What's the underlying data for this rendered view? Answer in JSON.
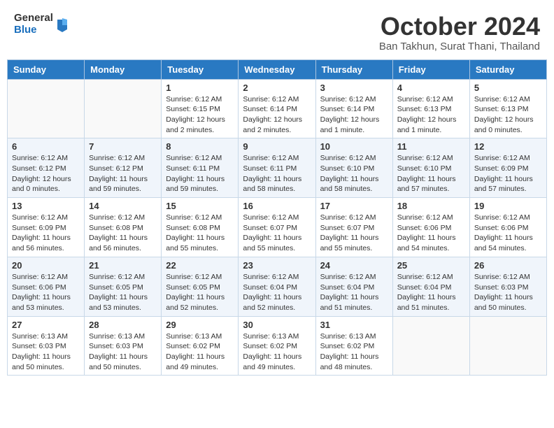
{
  "header": {
    "logo": {
      "general": "General",
      "blue": "Blue"
    },
    "title": "October 2024",
    "location": "Ban Takhun, Surat Thani, Thailand"
  },
  "days_of_week": [
    "Sunday",
    "Monday",
    "Tuesday",
    "Wednesday",
    "Thursday",
    "Friday",
    "Saturday"
  ],
  "weeks": [
    [
      {
        "day": "",
        "detail": ""
      },
      {
        "day": "",
        "detail": ""
      },
      {
        "day": "1",
        "detail": "Sunrise: 6:12 AM\nSunset: 6:15 PM\nDaylight: 12 hours and 2 minutes."
      },
      {
        "day": "2",
        "detail": "Sunrise: 6:12 AM\nSunset: 6:14 PM\nDaylight: 12 hours and 2 minutes."
      },
      {
        "day": "3",
        "detail": "Sunrise: 6:12 AM\nSunset: 6:14 PM\nDaylight: 12 hours and 1 minute."
      },
      {
        "day": "4",
        "detail": "Sunrise: 6:12 AM\nSunset: 6:13 PM\nDaylight: 12 hours and 1 minute."
      },
      {
        "day": "5",
        "detail": "Sunrise: 6:12 AM\nSunset: 6:13 PM\nDaylight: 12 hours and 0 minutes."
      }
    ],
    [
      {
        "day": "6",
        "detail": "Sunrise: 6:12 AM\nSunset: 6:12 PM\nDaylight: 12 hours and 0 minutes."
      },
      {
        "day": "7",
        "detail": "Sunrise: 6:12 AM\nSunset: 6:12 PM\nDaylight: 11 hours and 59 minutes."
      },
      {
        "day": "8",
        "detail": "Sunrise: 6:12 AM\nSunset: 6:11 PM\nDaylight: 11 hours and 59 minutes."
      },
      {
        "day": "9",
        "detail": "Sunrise: 6:12 AM\nSunset: 6:11 PM\nDaylight: 11 hours and 58 minutes."
      },
      {
        "day": "10",
        "detail": "Sunrise: 6:12 AM\nSunset: 6:10 PM\nDaylight: 11 hours and 58 minutes."
      },
      {
        "day": "11",
        "detail": "Sunrise: 6:12 AM\nSunset: 6:10 PM\nDaylight: 11 hours and 57 minutes."
      },
      {
        "day": "12",
        "detail": "Sunrise: 6:12 AM\nSunset: 6:09 PM\nDaylight: 11 hours and 57 minutes."
      }
    ],
    [
      {
        "day": "13",
        "detail": "Sunrise: 6:12 AM\nSunset: 6:09 PM\nDaylight: 11 hours and 56 minutes."
      },
      {
        "day": "14",
        "detail": "Sunrise: 6:12 AM\nSunset: 6:08 PM\nDaylight: 11 hours and 56 minutes."
      },
      {
        "day": "15",
        "detail": "Sunrise: 6:12 AM\nSunset: 6:08 PM\nDaylight: 11 hours and 55 minutes."
      },
      {
        "day": "16",
        "detail": "Sunrise: 6:12 AM\nSunset: 6:07 PM\nDaylight: 11 hours and 55 minutes."
      },
      {
        "day": "17",
        "detail": "Sunrise: 6:12 AM\nSunset: 6:07 PM\nDaylight: 11 hours and 55 minutes."
      },
      {
        "day": "18",
        "detail": "Sunrise: 6:12 AM\nSunset: 6:06 PM\nDaylight: 11 hours and 54 minutes."
      },
      {
        "day": "19",
        "detail": "Sunrise: 6:12 AM\nSunset: 6:06 PM\nDaylight: 11 hours and 54 minutes."
      }
    ],
    [
      {
        "day": "20",
        "detail": "Sunrise: 6:12 AM\nSunset: 6:06 PM\nDaylight: 11 hours and 53 minutes."
      },
      {
        "day": "21",
        "detail": "Sunrise: 6:12 AM\nSunset: 6:05 PM\nDaylight: 11 hours and 53 minutes."
      },
      {
        "day": "22",
        "detail": "Sunrise: 6:12 AM\nSunset: 6:05 PM\nDaylight: 11 hours and 52 minutes."
      },
      {
        "day": "23",
        "detail": "Sunrise: 6:12 AM\nSunset: 6:04 PM\nDaylight: 11 hours and 52 minutes."
      },
      {
        "day": "24",
        "detail": "Sunrise: 6:12 AM\nSunset: 6:04 PM\nDaylight: 11 hours and 51 minutes."
      },
      {
        "day": "25",
        "detail": "Sunrise: 6:12 AM\nSunset: 6:04 PM\nDaylight: 11 hours and 51 minutes."
      },
      {
        "day": "26",
        "detail": "Sunrise: 6:12 AM\nSunset: 6:03 PM\nDaylight: 11 hours and 50 minutes."
      }
    ],
    [
      {
        "day": "27",
        "detail": "Sunrise: 6:13 AM\nSunset: 6:03 PM\nDaylight: 11 hours and 50 minutes."
      },
      {
        "day": "28",
        "detail": "Sunrise: 6:13 AM\nSunset: 6:03 PM\nDaylight: 11 hours and 50 minutes."
      },
      {
        "day": "29",
        "detail": "Sunrise: 6:13 AM\nSunset: 6:02 PM\nDaylight: 11 hours and 49 minutes."
      },
      {
        "day": "30",
        "detail": "Sunrise: 6:13 AM\nSunset: 6:02 PM\nDaylight: 11 hours and 49 minutes."
      },
      {
        "day": "31",
        "detail": "Sunrise: 6:13 AM\nSunset: 6:02 PM\nDaylight: 11 hours and 48 minutes."
      },
      {
        "day": "",
        "detail": ""
      },
      {
        "day": "",
        "detail": ""
      }
    ]
  ]
}
